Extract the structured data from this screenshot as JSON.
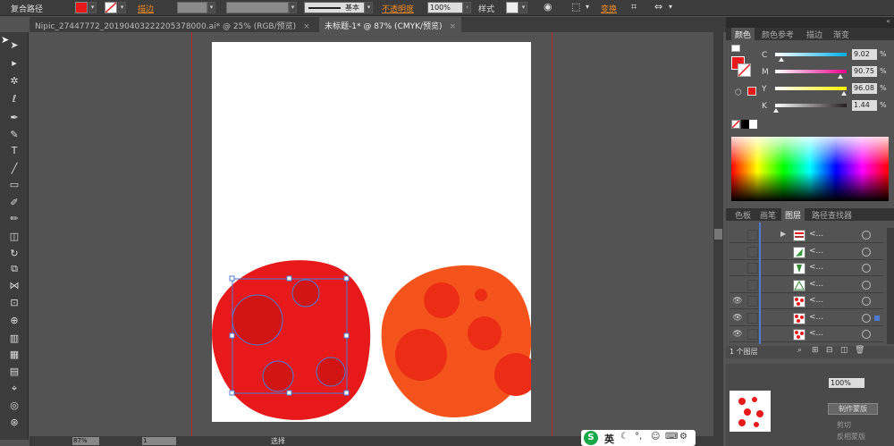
{
  "control_bar": {
    "object_type": "复合路径",
    "stroke_label": "描边",
    "stroke_style": "基本",
    "opacity_label": "不透明度",
    "opacity_value": "100%",
    "style_label": "样式",
    "transform_label": "变换",
    "fill_color": "#e8191a"
  },
  "doc_tabs": [
    {
      "label": "Nipic_27447772_20190403222205378000.ai* @ 25% (RGB/预览)",
      "close": "×",
      "active": false
    },
    {
      "label": "未标题-1* @ 87% (CMYK/预览)",
      "close": "×",
      "active": true
    }
  ],
  "color_panel": {
    "tabs": [
      "颜色",
      "颜色参考",
      "描边",
      "渐变"
    ],
    "sliders": [
      {
        "label": "C",
        "value": "9.02",
        "unit": "%",
        "level": 0.09,
        "color": "#00aeef"
      },
      {
        "label": "M",
        "value": "90.75",
        "unit": "%",
        "level": 0.9075,
        "color": "#ec008c"
      },
      {
        "label": "Y",
        "value": "96.08",
        "unit": "%",
        "level": 0.9608,
        "color": "#fff200"
      },
      {
        "label": "K",
        "value": "1.44",
        "unit": "%",
        "level": 0.0144,
        "color": "#231f20"
      }
    ]
  },
  "layers_panel": {
    "tabs": [
      "色板",
      "画笔",
      "图层",
      "路径查找器"
    ],
    "rows": [
      {
        "name": "<...",
        "visible": false,
        "thumb": "red-stripes"
      },
      {
        "name": "<...",
        "visible": false,
        "thumb": "green-leaf"
      },
      {
        "name": "<...",
        "visible": false,
        "thumb": "green-stroke"
      },
      {
        "name": "<...",
        "visible": false,
        "thumb": "green-triangle"
      },
      {
        "name": "<...",
        "visible": true,
        "thumb": "red-dots"
      },
      {
        "name": "<...",
        "visible": true,
        "thumb": "red-dots"
      },
      {
        "name": "<...",
        "visible": true,
        "thumb": "red-dots"
      }
    ],
    "footer": "1 个图层",
    "opacity_value": "100%",
    "mask_button": "制作蒙版",
    "clip_label": "剪切",
    "invert_label": "反相蒙版"
  },
  "status_bar": {
    "zoom": "87%",
    "page": "1",
    "tool_label": "选择"
  },
  "ime": {
    "lang": "英"
  },
  "colors": {
    "red_shape": "#e8191a",
    "red_spots": "#d11512",
    "orange_shape": "#f4541c",
    "orange_spots": "#ec2c14",
    "selection": "#4e7bd0"
  }
}
